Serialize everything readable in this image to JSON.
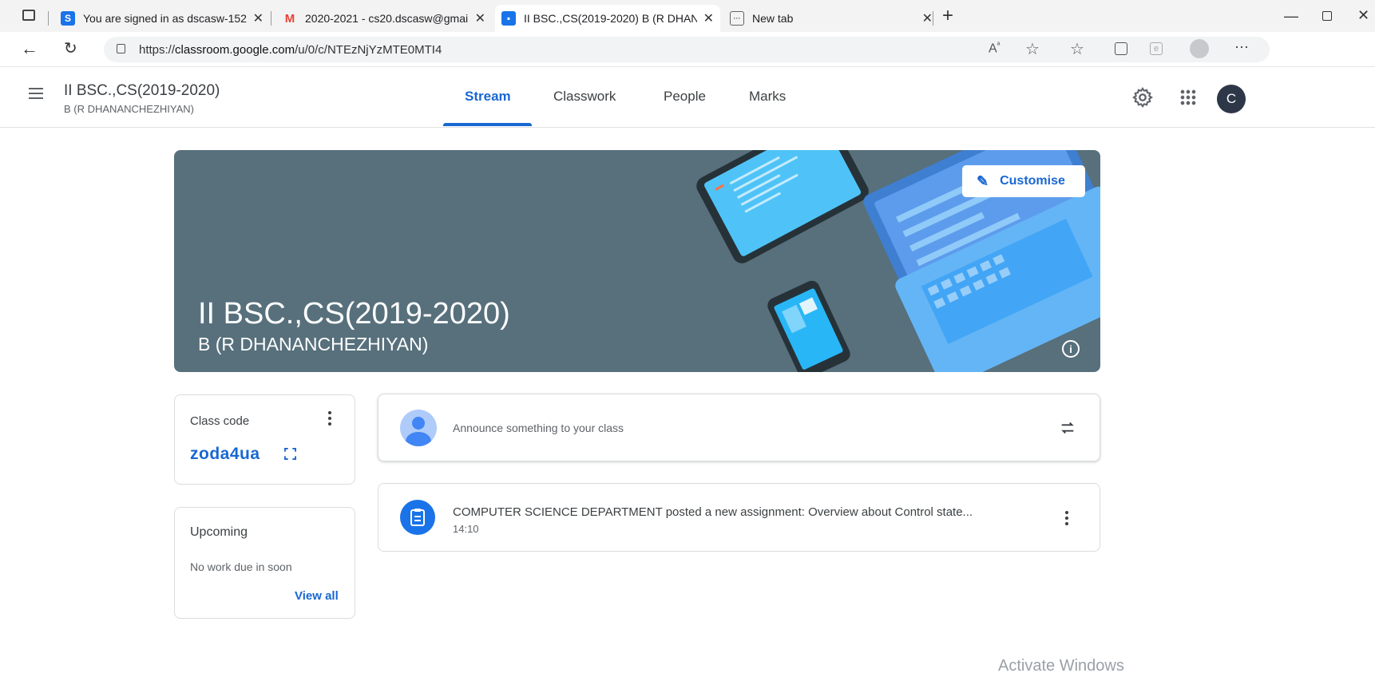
{
  "browser": {
    "tabs": [
      {
        "title": "You are signed in as dscasw-152",
        "favicon": "s-icon",
        "color": "#1a73e8"
      },
      {
        "title": "2020-2021 - cs20.dscasw@gmail",
        "favicon": "gmail-icon",
        "color": "#ea4335"
      },
      {
        "title": "II BSC.,CS(2019-2020) B (R DHAN",
        "favicon": "classroom-icon",
        "color": "#1a73e8"
      },
      {
        "title": "New tab",
        "favicon": "newtab-icon",
        "color": "#5f6368"
      }
    ],
    "url_prefix": "https://",
    "url_domain": "classroom.google.com",
    "url_path": "/u/0/c/NTEzNjYzMTE0MTI4"
  },
  "header": {
    "class_title": "II BSC.,CS(2019-2020)",
    "class_subtitle": "B (R DHANANCHEZHIYAN)",
    "tabs": [
      "Stream",
      "Classwork",
      "People",
      "Marks"
    ],
    "active_tab": "Stream",
    "avatar_letter": "C"
  },
  "banner": {
    "title": "II BSC.,CS(2019-2020)",
    "subtitle": "B (R DHANANCHEZHIYAN)",
    "customise_label": "Customise",
    "info_icon": "i"
  },
  "class_code": {
    "label": "Class code",
    "value": "zoda4ua"
  },
  "upcoming": {
    "label": "Upcoming",
    "empty_text": "No work due in soon",
    "view_all": "View all"
  },
  "announce": {
    "placeholder": "Announce something to your class"
  },
  "post": {
    "title": "COMPUTER SCIENCE DEPARTMENT posted a new assignment: Overview about Control state...",
    "time": "14:10"
  },
  "watermark": "Activate Windows",
  "colors": {
    "accent": "#1967d2",
    "banner_bg": "#57707c"
  }
}
